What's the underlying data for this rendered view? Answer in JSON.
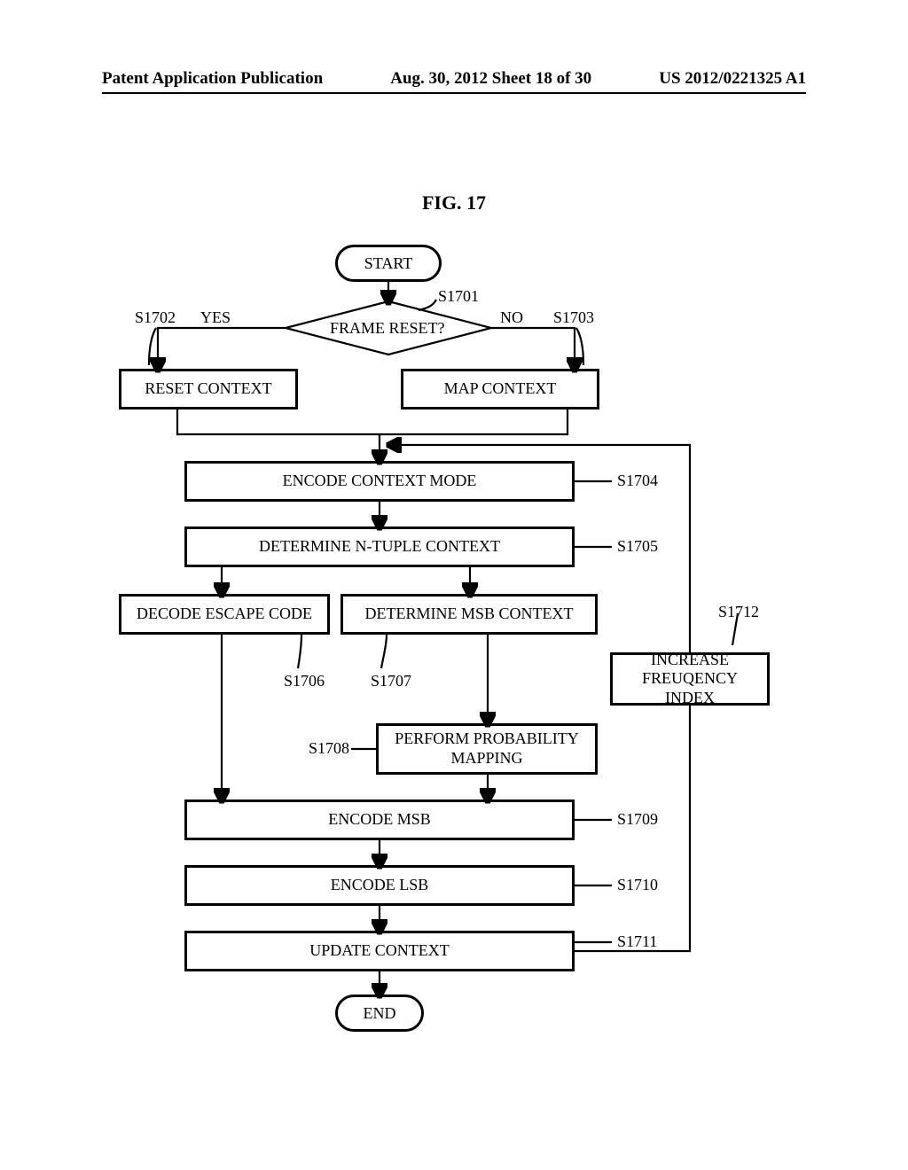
{
  "header": {
    "left": "Patent Application Publication",
    "center": "Aug. 30, 2012  Sheet 18 of 30",
    "right": "US 2012/0221325 A1"
  },
  "figure_title": "FIG. 17",
  "nodes": {
    "start": "START",
    "end": "END",
    "decision": "FRAME RESET?",
    "yes": "YES",
    "no": "NO",
    "reset_context": "RESET CONTEXT",
    "map_context": "MAP CONTEXT",
    "encode_context_mode": "ENCODE CONTEXT MODE",
    "determine_ntuple": "DETERMINE N-TUPLE CONTEXT",
    "decode_escape": "DECODE ESCAPE CODE",
    "determine_msb_context": "DETERMINE MSB CONTEXT",
    "increase_freq": "INCREASE\nFREUQENCY INDEX",
    "perform_prob_mapping": "PERFORM PROBABILITY\nMAPPING",
    "encode_msb": "ENCODE MSB",
    "encode_lsb": "ENCODE LSB",
    "update_context": "UPDATE CONTEXT"
  },
  "step_labels": {
    "s1701": "S1701",
    "s1702": "S1702",
    "s1703": "S1703",
    "s1704": "S1704",
    "s1705": "S1705",
    "s1706": "S1706",
    "s1707": "S1707",
    "s1708": "S1708",
    "s1709": "S1709",
    "s1710": "S1710",
    "s1711": "S1711",
    "s1712": "S1712"
  },
  "chart_data": {
    "type": "flowchart",
    "title": "FIG. 17",
    "nodes": [
      {
        "id": "start",
        "type": "terminator",
        "label": "START"
      },
      {
        "id": "s1701",
        "type": "decision",
        "label": "FRAME RESET?"
      },
      {
        "id": "s1702",
        "type": "process",
        "label": "RESET CONTEXT"
      },
      {
        "id": "s1703",
        "type": "process",
        "label": "MAP CONTEXT"
      },
      {
        "id": "s1704",
        "type": "process",
        "label": "ENCODE CONTEXT MODE"
      },
      {
        "id": "s1705",
        "type": "process",
        "label": "DETERMINE N-TUPLE CONTEXT"
      },
      {
        "id": "s1706",
        "type": "process",
        "label": "DECODE ESCAPE CODE"
      },
      {
        "id": "s1707",
        "type": "process",
        "label": "DETERMINE MSB CONTEXT"
      },
      {
        "id": "s1708",
        "type": "process",
        "label": "PERFORM PROBABILITY MAPPING"
      },
      {
        "id": "s1709",
        "type": "process",
        "label": "ENCODE MSB"
      },
      {
        "id": "s1710",
        "type": "process",
        "label": "ENCODE LSB"
      },
      {
        "id": "s1711",
        "type": "process",
        "label": "UPDATE CONTEXT"
      },
      {
        "id": "s1712",
        "type": "process",
        "label": "INCREASE FREUQENCY INDEX"
      },
      {
        "id": "end",
        "type": "terminator",
        "label": "END"
      }
    ],
    "edges": [
      {
        "from": "start",
        "to": "s1701"
      },
      {
        "from": "s1701",
        "to": "s1702",
        "label": "YES"
      },
      {
        "from": "s1701",
        "to": "s1703",
        "label": "NO"
      },
      {
        "from": "s1702",
        "to": "s1704"
      },
      {
        "from": "s1703",
        "to": "s1704"
      },
      {
        "from": "s1704",
        "to": "s1705"
      },
      {
        "from": "s1705",
        "to": "s1706"
      },
      {
        "from": "s1705",
        "to": "s1707"
      },
      {
        "from": "s1707",
        "to": "s1708"
      },
      {
        "from": "s1706",
        "to": "s1709"
      },
      {
        "from": "s1708",
        "to": "s1709"
      },
      {
        "from": "s1709",
        "to": "s1710"
      },
      {
        "from": "s1710",
        "to": "s1711"
      },
      {
        "from": "s1711",
        "to": "end"
      },
      {
        "from": "s1711",
        "to": "s1712"
      },
      {
        "from": "s1712",
        "to": "s1704"
      }
    ]
  }
}
